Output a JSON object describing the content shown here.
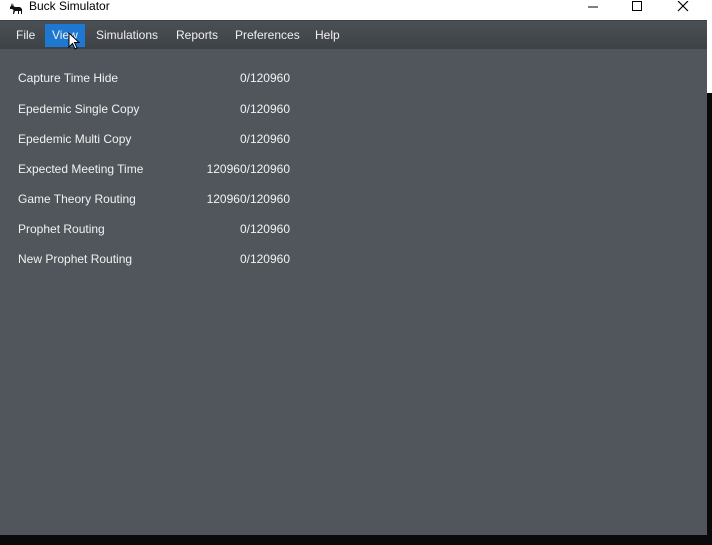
{
  "window": {
    "title": "Buck Simulator",
    "app_icon": "deer-icon",
    "controls": [
      "minimize-icon",
      "maximize-icon",
      "close-icon"
    ]
  },
  "menu": {
    "items": [
      {
        "label": "File",
        "active": false
      },
      {
        "label": "View",
        "active": true
      },
      {
        "label": "Simulations",
        "active": false
      },
      {
        "label": "Reports",
        "active": false
      },
      {
        "label": "Preferences",
        "active": false
      },
      {
        "label": "Help",
        "active": false
      }
    ]
  },
  "progress": {
    "rows": [
      {
        "label": "Capture Time Hide",
        "value": "0/120960"
      },
      {
        "label": "Epedemic Single Copy",
        "value": "0/120960"
      },
      {
        "label": "Epedemic Multi Copy",
        "value": "0/120960"
      },
      {
        "label": "Expected Meeting Time",
        "value": "120960/120960"
      },
      {
        "label": "Game Theory Routing",
        "value": "120960/120960"
      },
      {
        "label": "Prophet Routing",
        "value": "0/120960"
      },
      {
        "label": "New Prophet Routing",
        "value": "0/120960"
      }
    ]
  },
  "colors": {
    "background": "#50565c",
    "menubar": "#41464b",
    "menu_active": "#1e78d2",
    "text": "#f2f2f2"
  }
}
